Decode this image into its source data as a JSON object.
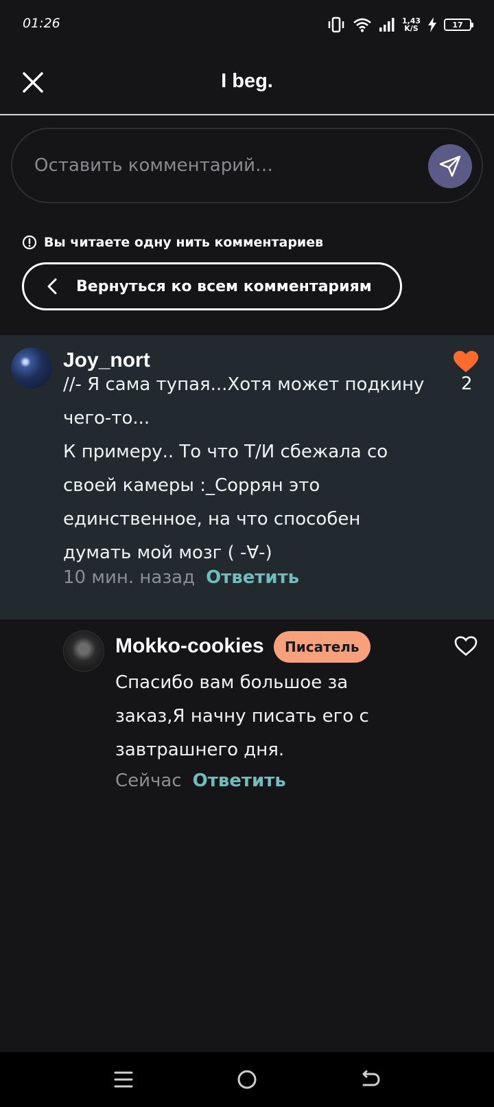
{
  "status_bar": {
    "time": "01:26",
    "speed_value": "1,43",
    "speed_unit": "K/S",
    "battery": "17"
  },
  "header": {
    "title": "I beg."
  },
  "comment_input": {
    "placeholder": "Оставить комментарий…"
  },
  "thread": {
    "notice": "Вы читаете одну нить комментариев",
    "back_label": "Вернуться ко всем комментариям"
  },
  "comments": [
    {
      "author": "Joy_nort",
      "lines": [
        "//- Я сама тупая...Хотя может подкину",
        "чего-то...",
        "К примеру.. То что Т/И сбежала со",
        "своей камеры :_Соррян это",
        "единственное, на что способен",
        "думать мой мозг (     -∀-)"
      ],
      "time": "10 мин. назад",
      "reply_label": "Ответить",
      "likes": "2",
      "liked": true,
      "like_color": "#ff6b2c"
    },
    {
      "author": "Mokko-cookies",
      "badge": "Писатель",
      "lines": [
        "Спасибо вам большое за",
        "заказ,Я начну писать его с",
        "завтрашнего дня."
      ],
      "time": "Сейчас",
      "reply_label": "Ответить",
      "liked": false
    }
  ],
  "colors": {
    "background": "#151417",
    "thread_highlight": "#222a2f",
    "reply_link": "#73bcbc",
    "badge": "#f7a07c",
    "send_button": "#5c5a86"
  }
}
